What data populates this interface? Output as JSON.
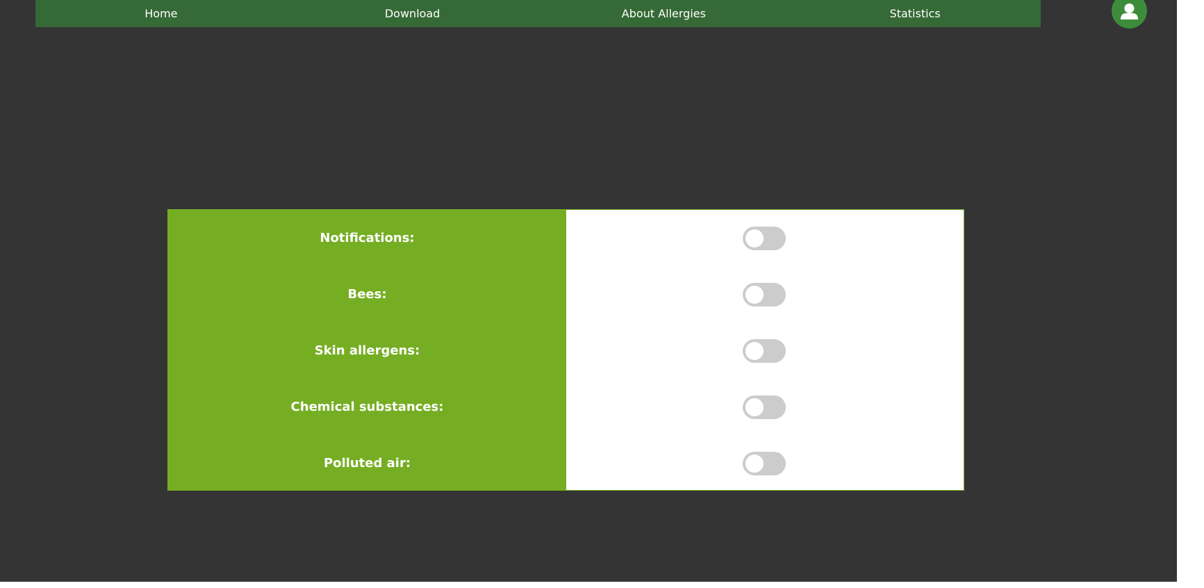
{
  "nav": {
    "items": [
      {
        "label": "Home"
      },
      {
        "label": "Download"
      },
      {
        "label": "About Allergies"
      },
      {
        "label": "Statistics"
      }
    ]
  },
  "avatar": {
    "icon": "user-icon"
  },
  "settings": {
    "rows": [
      {
        "label": "Notifications:",
        "enabled": false
      },
      {
        "label": "Bees:",
        "enabled": false
      },
      {
        "label": "Skin allergens:",
        "enabled": false
      },
      {
        "label": "Chemical substances:",
        "enabled": false
      },
      {
        "label": "Polluted air:",
        "enabled": false
      }
    ]
  },
  "colors": {
    "background": "#343434",
    "navbar": "#356935",
    "label_column": "#76ae23",
    "toggle_off": "#cccccc",
    "avatar": "#3c8c3c"
  }
}
